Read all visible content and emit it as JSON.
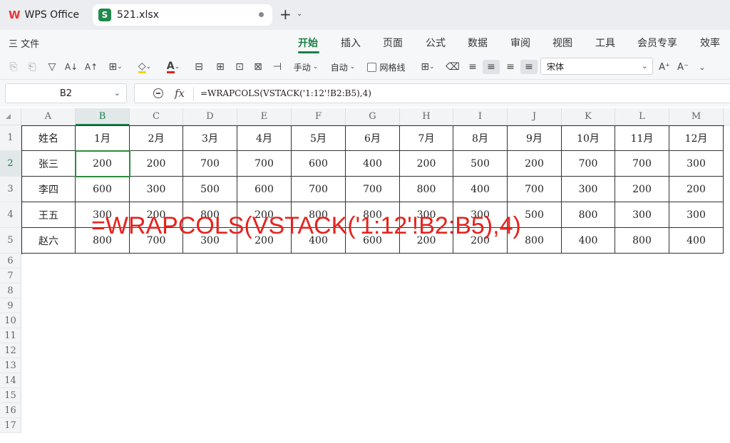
{
  "tabs": [
    {
      "label": "WPS Office",
      "icon": "wps-logo-icon"
    },
    {
      "label": "521.xlsx",
      "icon": "spreadsheet-icon",
      "icon_letter": "S"
    }
  ],
  "menu": {
    "file_label": "三 文件",
    "items": [
      "开始",
      "插入",
      "页面",
      "公式",
      "数据",
      "审阅",
      "视图",
      "工具",
      "会员专享",
      "效率"
    ],
    "active": "开始"
  },
  "toolbar": {
    "wrap_label": "手动",
    "autofit_label": "自动",
    "gridlines_label": "网格线",
    "font_name": "宋体"
  },
  "formula_bar": {
    "cell_ref": "B2",
    "formula": "=WRAPCOLS(VSTACK('1:12'!B2:B5),4)"
  },
  "sheet": {
    "columns": [
      "A",
      "B",
      "C",
      "D",
      "E",
      "F",
      "G",
      "H",
      "I",
      "J",
      "K",
      "L",
      "M"
    ],
    "row_numbers": [
      "1",
      "2",
      "3",
      "4",
      "5",
      "6",
      "7",
      "8",
      "9",
      "10",
      "11",
      "12",
      "13",
      "14",
      "15",
      "16",
      "17"
    ],
    "header_row": [
      "姓名",
      "1月",
      "2月",
      "3月",
      "4月",
      "5月",
      "6月",
      "7月",
      "8月",
      "9月",
      "10月",
      "11月",
      "12月"
    ],
    "data_rows": [
      [
        "张三",
        "200",
        "200",
        "700",
        "700",
        "600",
        "400",
        "200",
        "500",
        "200",
        "700",
        "700",
        "300"
      ],
      [
        "李四",
        "600",
        "300",
        "500",
        "600",
        "700",
        "700",
        "800",
        "400",
        "700",
        "300",
        "200",
        "200"
      ],
      [
        "王五",
        "300",
        "200",
        "800",
        "200",
        "800",
        "800",
        "300",
        "300",
        "500",
        "800",
        "300",
        "300"
      ],
      [
        "赵六",
        "800",
        "700",
        "300",
        "200",
        "400",
        "600",
        "200",
        "200",
        "800",
        "400",
        "800",
        "400"
      ]
    ],
    "selected_cell": "B2"
  },
  "annotation": "=WRAPCOLS(VSTACK('1:12'!B2:B5),4)",
  "colors": {
    "accent": "#1a7f46",
    "annotation": "#e6231e"
  }
}
